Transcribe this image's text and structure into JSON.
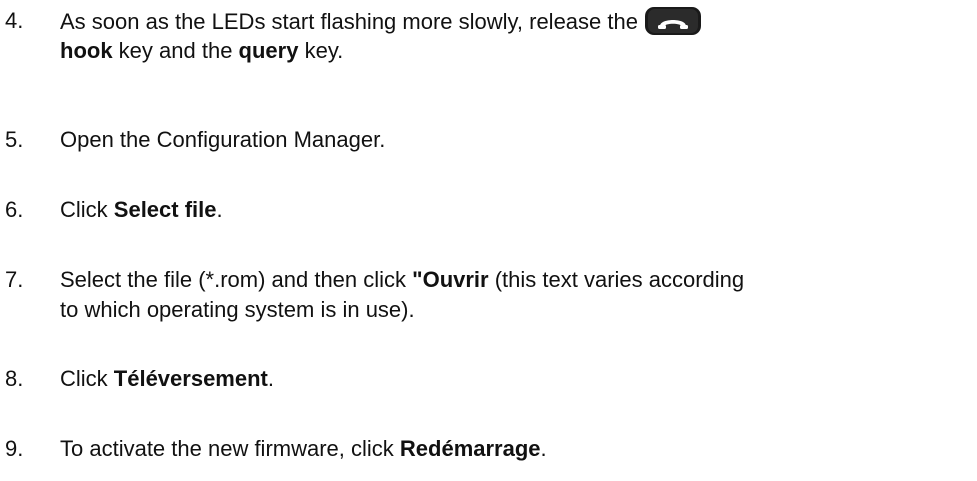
{
  "steps": [
    {
      "number": "4.",
      "line1_before": "As soon as the LEDs start flashing more slowly, release the",
      "icon": "hook-key-icon",
      "line2_bold1": "hook",
      "line2_mid": " key and the ",
      "line2_bold2": "query",
      "line2_after": " key."
    },
    {
      "number": "5.",
      "text": "Open the Configuration Manager."
    },
    {
      "number": "6.",
      "before": "Click ",
      "bold": "Select file",
      "after": "."
    },
    {
      "number": "7.",
      "line1_before": "Select the file (*.rom) and then click ",
      "line1_bold": "\"Ouvrir",
      "line1_after": " (this text varies according",
      "line2": "to which operating system is in use)."
    },
    {
      "number": "8.",
      "before": "Click ",
      "bold": "Téléversement",
      "after": "."
    },
    {
      "number": "9.",
      "before": "To activate the new firmware, click ",
      "bold": "Redémarrage",
      "after": "."
    }
  ]
}
